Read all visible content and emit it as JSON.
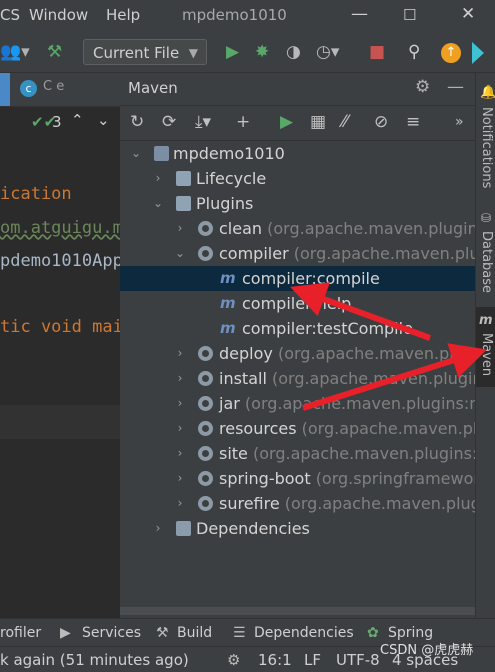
{
  "menubar": {
    "partial_menu": "CS",
    "window": "Window",
    "help": "Help",
    "title": "mpdemo1010"
  },
  "toolbar": {
    "run_config": "Current File"
  },
  "editor": {
    "tab_partial": "С е",
    "inspection_count": "3",
    "code_lines": [
      "ication",
      "om.atguigu.m",
      "pdemo1010App",
      "",
      "tic void mai"
    ]
  },
  "maven": {
    "title": "Maven",
    "tree": [
      {
        "label": "mpdemo1010",
        "detail": ""
      },
      {
        "label": "Lifecycle",
        "detail": ""
      },
      {
        "label": "Plugins",
        "detail": ""
      },
      {
        "label": "clean",
        "detail": "(org.apache.maven.plugins:m"
      },
      {
        "label": "compiler",
        "detail": "(org.apache.maven.plugin"
      },
      {
        "label": "compiler:compile",
        "detail": ""
      },
      {
        "label": "compiler:help",
        "detail": ""
      },
      {
        "label": "compiler:testCompile",
        "detail": ""
      },
      {
        "label": "deploy",
        "detail": "(org.apache.maven.plugins:"
      },
      {
        "label": "install",
        "detail": "(org.apache.maven.plugins:m"
      },
      {
        "label": "jar",
        "detail": "(org.apache.maven.plugins:mav"
      },
      {
        "label": "resources",
        "detail": "(org.apache.maven.plugi"
      },
      {
        "label": "site",
        "detail": "(org.apache.maven.plugins:mav"
      },
      {
        "label": "spring-boot",
        "detail": "(org.springframework."
      },
      {
        "label": "surefire",
        "detail": "(org.apache.maven.plugins"
      },
      {
        "label": "Dependencies",
        "detail": ""
      }
    ]
  },
  "right_stripe": {
    "notifications": "Notifications",
    "database": "Database",
    "maven": "Maven"
  },
  "bottom_tools": {
    "profiler": "rofiler",
    "services": "Services",
    "build": "Build",
    "dependencies": "Dependencies",
    "spring": "Spring"
  },
  "status": {
    "message": "k again (51 minutes ago)",
    "position": "16:1",
    "line_sep": "LF",
    "encoding": "UTF-8",
    "indent": "4 spaces",
    "watermark": "CSDN @虎虎赫"
  },
  "colors": {
    "background": "#2b2b2b",
    "panel": "#3c3f41",
    "selection": "#0d293e",
    "arrow": "#e8202a",
    "run": "#59a869",
    "code_orange": "#cc7832",
    "code_green": "#6a8759"
  }
}
